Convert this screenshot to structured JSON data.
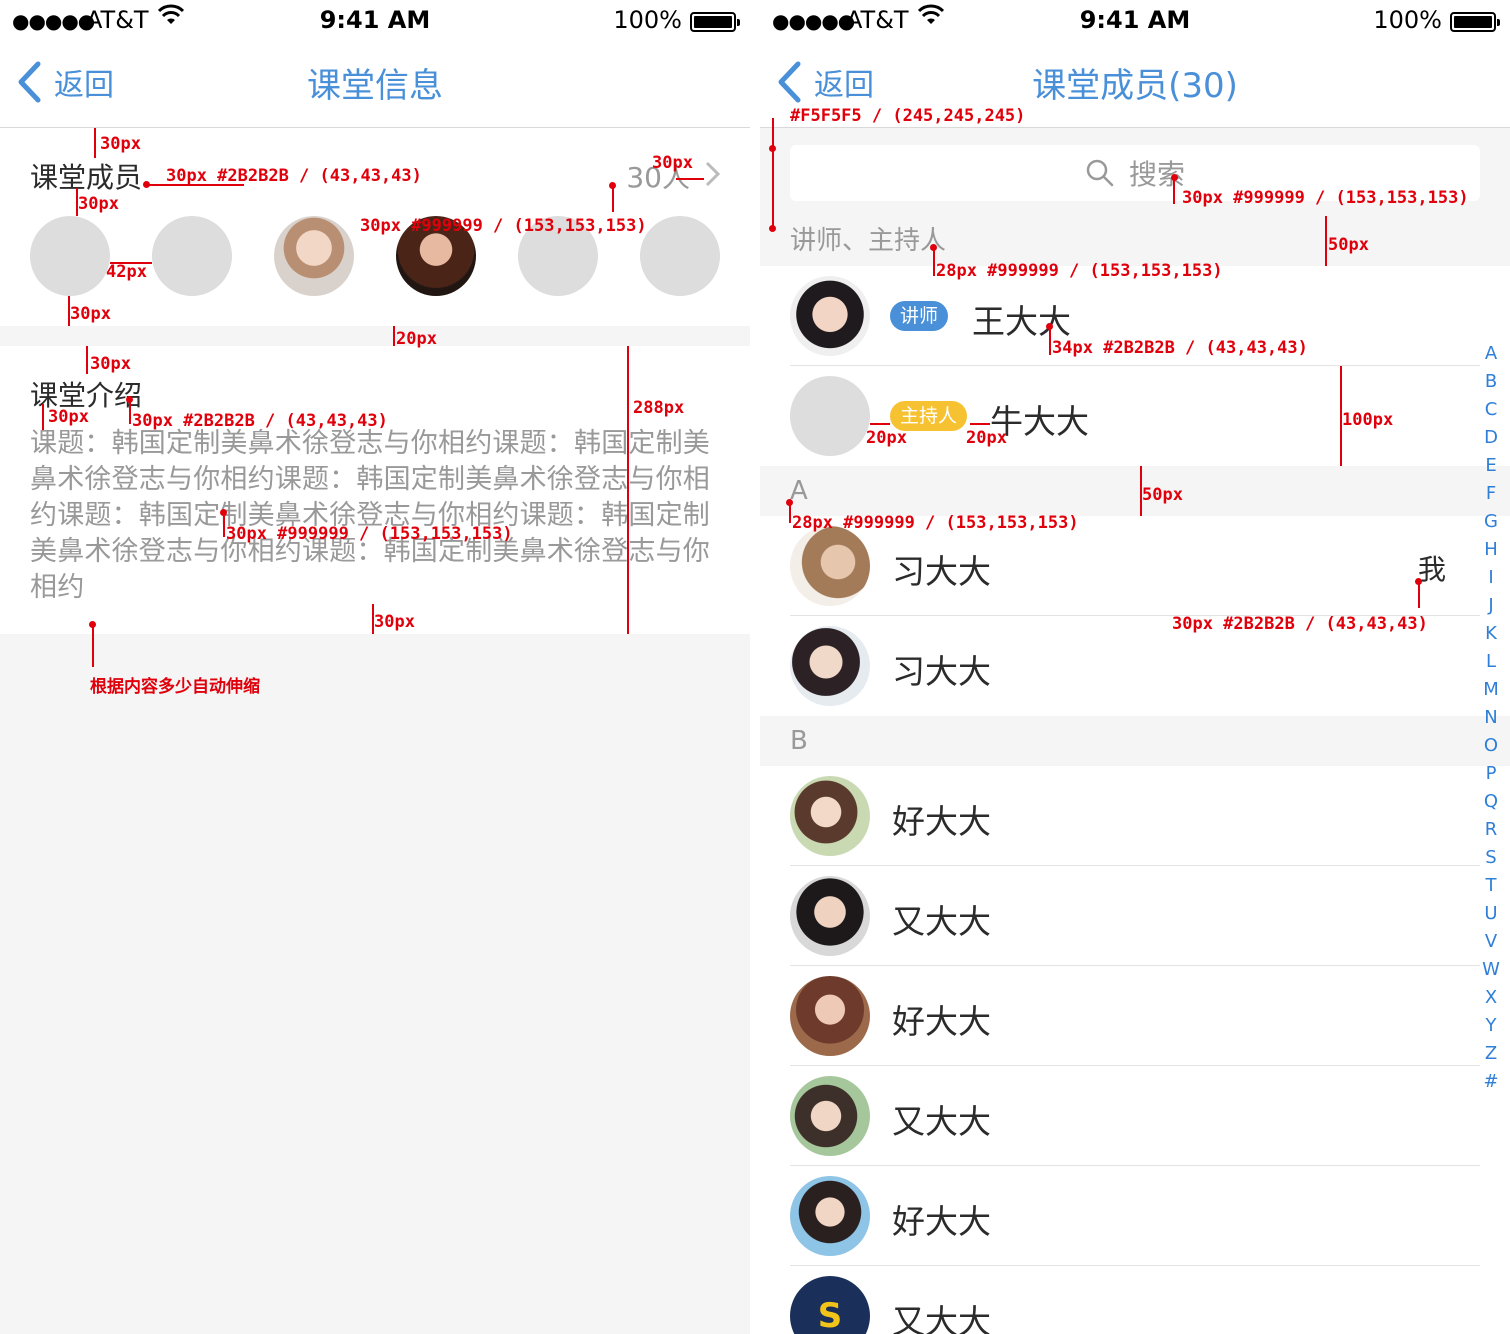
{
  "status_bar": {
    "signal": "●●●●●",
    "carrier": "AT&T",
    "time": "9:41 AM",
    "battery": "100%"
  },
  "left_screen": {
    "nav": {
      "back": "返回",
      "title": "课堂信息"
    },
    "members": {
      "label": "课堂成员",
      "count": "30人"
    },
    "intro": {
      "label": "课堂介绍",
      "body": "课题：韩国定制美鼻术徐登志与你相约课题：韩国定制美鼻术徐登志与你相约课题：韩国定制美鼻术徐登志与你相约课题：韩国定制美鼻术徐登志与你相约课题：韩国定制美鼻术徐登志与你相约课题：韩国定制美鼻术徐登志与你相约"
    },
    "annotations": {
      "a1": "30px",
      "a2": "30px #2B2B2B / (43,43,43)",
      "a3": "30px",
      "a4": "30px",
      "a5": "30px #999999 / (153,153,153)",
      "a6": "42px",
      "a7": "30px",
      "a8": "20px",
      "a9": "30px",
      "a10": "30px",
      "a11": "30px #2B2B2B / (43,43,43)",
      "a12": "288px",
      "a13": "30px #999999 / (153,153,153)",
      "a14": "30px",
      "a15": "根据内容多少自动伸缩"
    }
  },
  "right_screen": {
    "nav": {
      "back": "返回",
      "title": "课堂成员(30)"
    },
    "search": {
      "placeholder": "搜索"
    },
    "sections": {
      "staff": {
        "header": "讲师、主持人",
        "lecturer_badge": "讲师",
        "lecturer_name": "王大大",
        "host_badge": "主持人",
        "host_name": "牛大大"
      },
      "a": {
        "header": "A",
        "row1": "习大大",
        "row1_me": "我",
        "row2": "习大大"
      },
      "b": {
        "header": "B",
        "row1": "好大大",
        "row2": "又大大",
        "row3": "好大大",
        "row4": "又大大",
        "row5": "好大大",
        "row6": "又大大"
      }
    },
    "index": [
      "A",
      "B",
      "C",
      "D",
      "E",
      "F",
      "G",
      "H",
      "I",
      "J",
      "K",
      "L",
      "M",
      "N",
      "O",
      "P",
      "Q",
      "R",
      "S",
      "T",
      "U",
      "V",
      "W",
      "X",
      "Y",
      "Z",
      "#"
    ],
    "annotations": {
      "b1": "#F5F5F5 / (245,245,245)",
      "b2": "30px #999999 / (153,153,153)",
      "b3": "50px",
      "b4": "28px #999999 / (153,153,153)",
      "b5": "34px #2B2B2B / (43,43,43)",
      "b6": "100px",
      "b7": "20px",
      "b8": "20px",
      "b9": "50px",
      "b10": "28px #999999 / (153,153,153)",
      "b11": "30px #2B2B2B / (43,43,43)"
    }
  }
}
